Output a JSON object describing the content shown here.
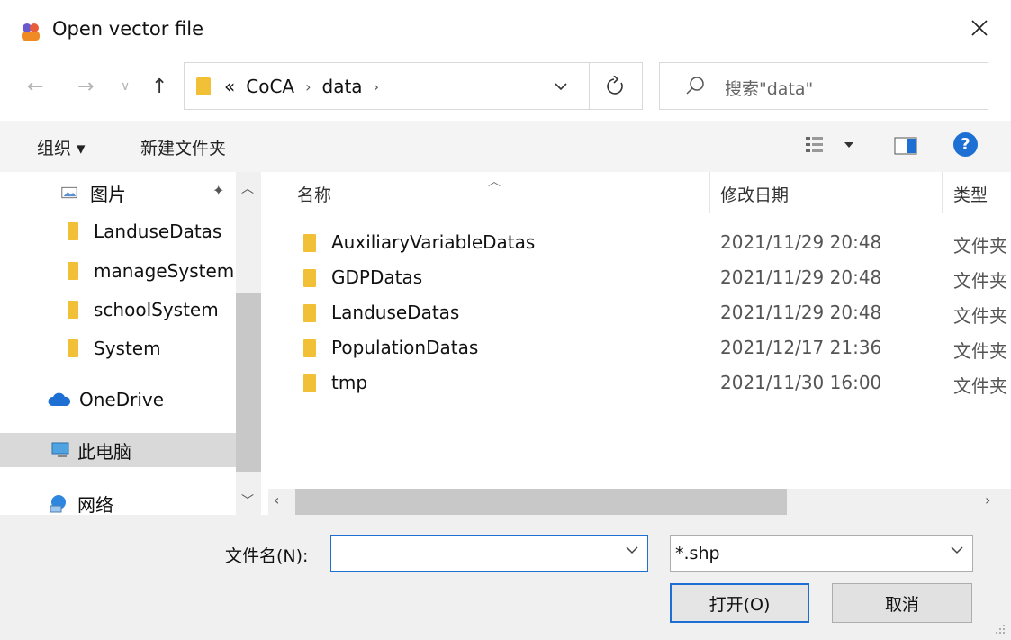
{
  "window": {
    "title": "Open vector file"
  },
  "address": {
    "overflow": "«",
    "crumbs": [
      "CoCA",
      "data"
    ]
  },
  "search": {
    "placeholder": "搜索\"data\""
  },
  "toolbar": {
    "organize": "组织 ▾",
    "new_folder": "新建文件夹"
  },
  "nav": {
    "items": [
      {
        "label": "图片",
        "icon": "pictures-icon"
      },
      {
        "label": "LanduseDatas",
        "icon": "folder-icon"
      },
      {
        "label": "manageSystem",
        "icon": "folder-icon"
      },
      {
        "label": "schoolSystem",
        "icon": "folder-icon"
      },
      {
        "label": "System",
        "icon": "folder-icon"
      },
      {
        "label": "OneDrive",
        "icon": "cloud-icon"
      },
      {
        "label": "此电脑",
        "icon": "computer-icon",
        "selected": true
      },
      {
        "label": "网络",
        "icon": "network-icon"
      }
    ]
  },
  "filelist": {
    "headers": {
      "name": "名称",
      "modified": "修改日期",
      "type": "类型"
    },
    "rows": [
      {
        "name": "AuxiliaryVariableDatas",
        "modified": "2021/11/29 20:48",
        "type": "文件夹"
      },
      {
        "name": "GDPDatas",
        "modified": "2021/11/29 20:48",
        "type": "文件夹"
      },
      {
        "name": "LanduseDatas",
        "modified": "2021/11/29 20:48",
        "type": "文件夹"
      },
      {
        "name": "PopulationDatas",
        "modified": "2021/12/17 21:36",
        "type": "文件夹"
      },
      {
        "name": "tmp",
        "modified": "2021/11/30 16:00",
        "type": "文件夹"
      }
    ]
  },
  "footer": {
    "filename_label": "文件名(N):",
    "filename_value": "",
    "filter_value": "*.shp",
    "open_label": "打开(O)",
    "cancel_label": "取消"
  },
  "colors": {
    "accent": "#1d6fd3",
    "folder": "#f2c037",
    "selected_bg": "#d9d9d9"
  }
}
